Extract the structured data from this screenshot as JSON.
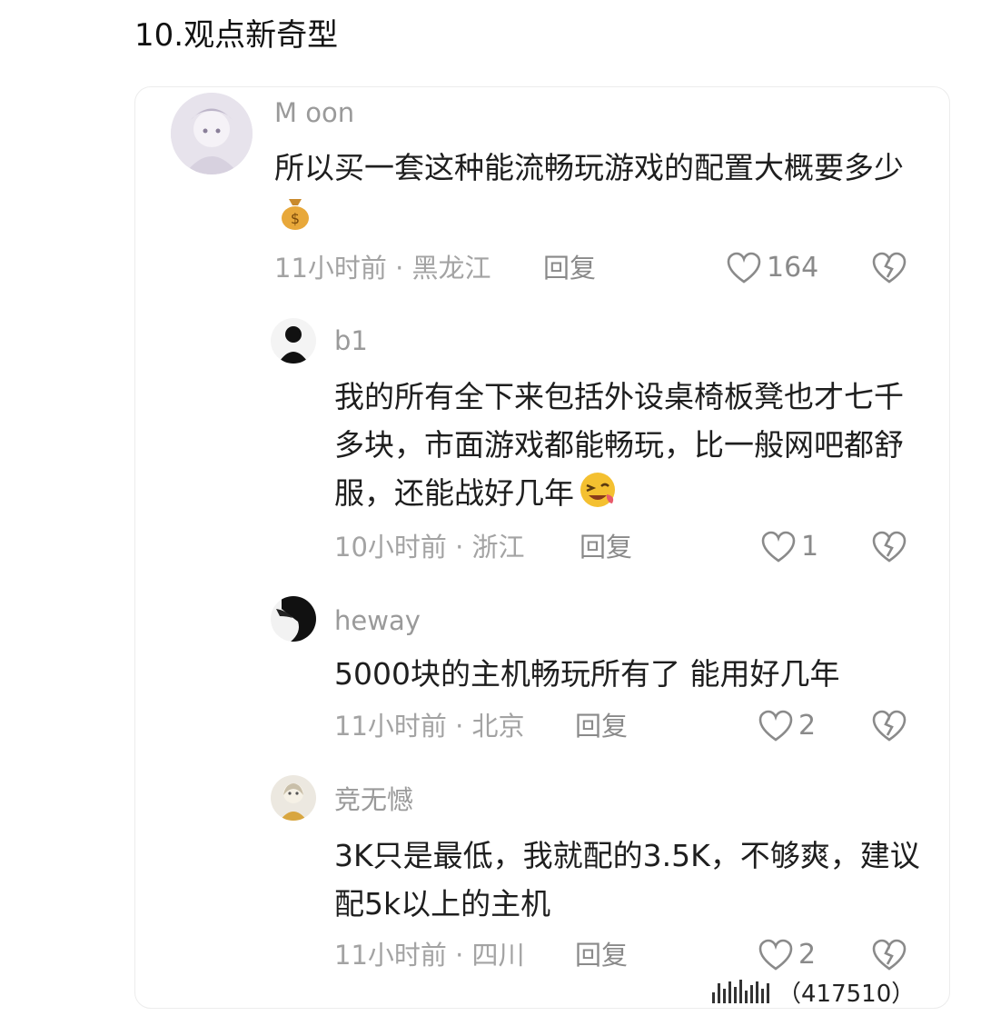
{
  "heading": "10.观点新奇型",
  "comments": [
    {
      "username": "M oon",
      "text": "所以买一套这种能流畅玩游戏的配置大概要多少",
      "emoji": "money-bag",
      "meta": "11小时前 · 黑龙江",
      "reply": "回复",
      "likes": "164"
    },
    {
      "username": "b1",
      "text": "我的所有全下来包括外设桌椅板凳也才七千多块，市面游戏都能畅玩，比一般网吧都舒服，还能战好几年",
      "emoji": "winking-face",
      "meta": "10小时前 · 浙江",
      "reply": "回复",
      "likes": "1"
    },
    {
      "username": "heway",
      "text": "5000块的主机畅玩所有了  能用好几年",
      "meta": "11小时前 · 北京",
      "reply": "回复",
      "likes": "2"
    },
    {
      "username": "竞无憾",
      "text": "3K只是最低，我就配的3.5K，不够爽，建议配5k以上的主机",
      "meta": "11小时前 · 四川",
      "reply": "回复",
      "likes": "2"
    }
  ],
  "watermark": {
    "number": "（417510）"
  },
  "colors": {
    "text": "#1e1e1e",
    "muted": "#a3a3a3",
    "border": "#ececec"
  }
}
